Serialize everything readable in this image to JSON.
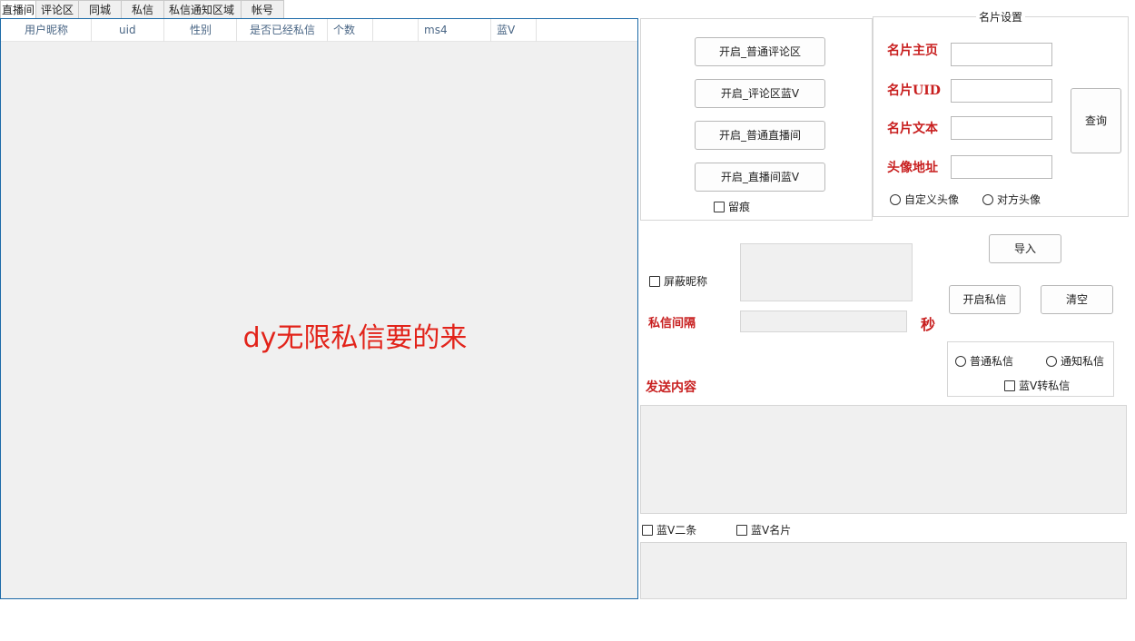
{
  "tabs": [
    {
      "label": "直播间"
    },
    {
      "label": "评论区"
    },
    {
      "label": "同城"
    },
    {
      "label": "私信"
    },
    {
      "label": "私信通知区域"
    },
    {
      "label": "帐号"
    }
  ],
  "table": {
    "columns": [
      "用户昵称",
      "uid",
      "性别",
      "是否已经私信",
      "个数",
      "",
      "ms4",
      "蓝V"
    ],
    "watermark": "dy无限私信要的来"
  },
  "open_buttons": {
    "normal_comment": "开启_普通评论区",
    "comment_bluev": "开启_评论区蓝V",
    "normal_live": "开启_普通直播间",
    "live_bluev": "开启_直播间蓝V",
    "leave_trace": "留痕"
  },
  "card_settings": {
    "title": "名片设置",
    "home_label": "名片主页",
    "uid_label": "名片UID",
    "text_label": "名片文本",
    "avatar_label": "头像地址",
    "query_button": "查询",
    "custom_avatar": "自定义头像",
    "other_avatar": "对方头像"
  },
  "messaging": {
    "import_button": "导入",
    "mask_nickname": "屏蔽昵称",
    "interval_label": "私信间隔",
    "seconds_unit": "秒",
    "start_button": "开启私信",
    "clear_button": "清空",
    "normal_msg": "普通私信",
    "notify_msg": "通知私信",
    "bluev_to_msg": "蓝V转私信",
    "content_label": "发送内容",
    "bluev_second": "蓝V二条",
    "bluev_card": "蓝V名片"
  }
}
